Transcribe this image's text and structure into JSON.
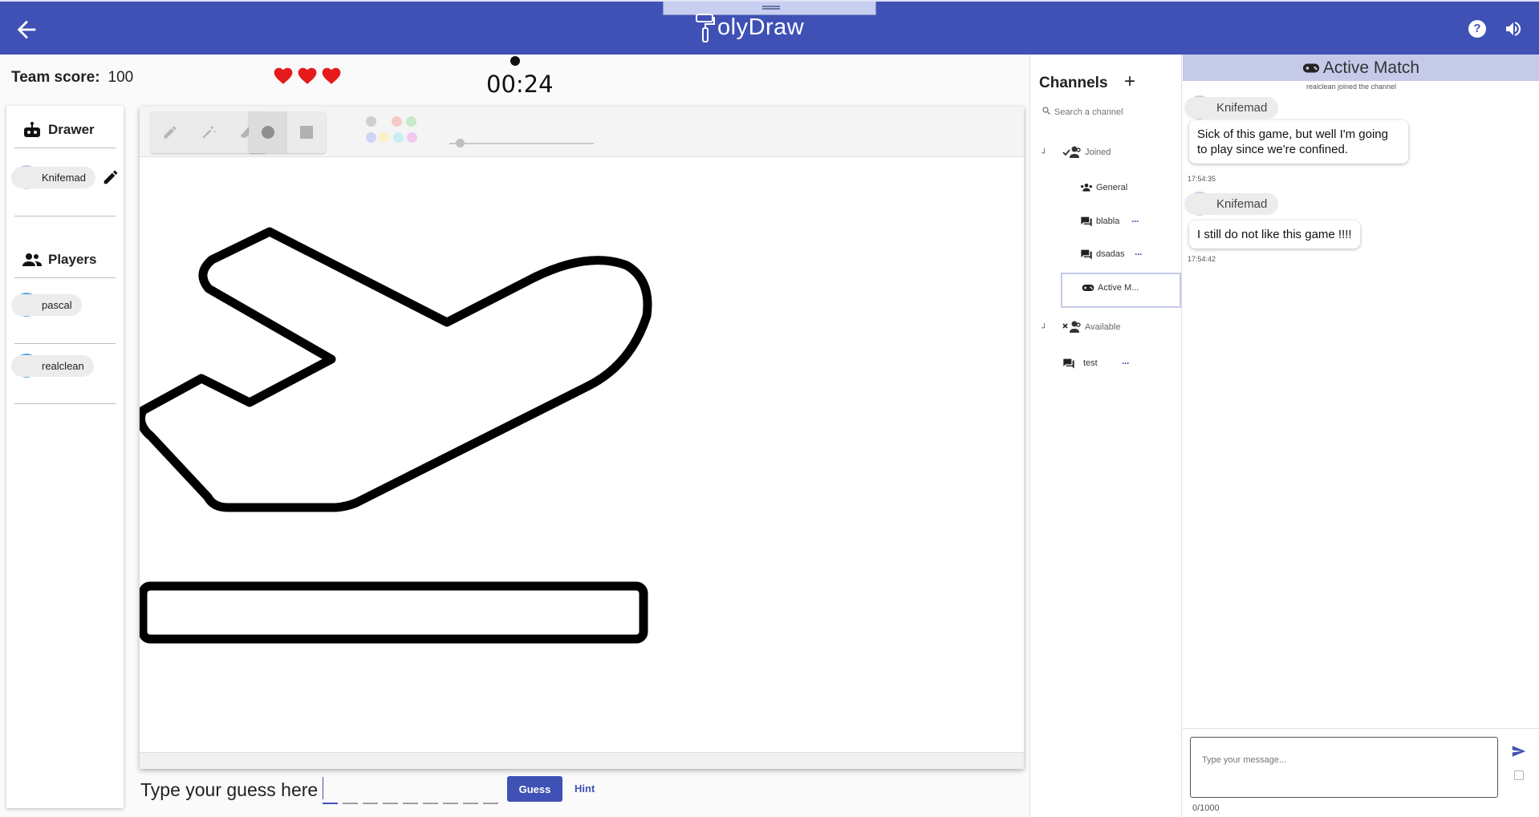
{
  "header": {
    "app_name": "olyDraw",
    "back_icon": "arrow-left-icon",
    "help_icon": "help-circle-icon",
    "sound_icon": "volume-icon"
  },
  "game": {
    "team_score_label": "Team score:",
    "team_score_value": "100",
    "lives": 3,
    "timer": "00:24"
  },
  "left_panel": {
    "drawer_title": "Drawer",
    "drawer": {
      "name": "Knifemad"
    },
    "players_title": "Players",
    "players": [
      {
        "name": "pascal"
      },
      {
        "name": "realclean"
      }
    ]
  },
  "toolbar": {
    "tools": [
      "pencil-icon",
      "magic-pen-icon",
      "eraser-icon"
    ],
    "shapes": [
      "circle-icon",
      "square-icon"
    ],
    "colors": [
      "#cfcfcf",
      "#f6c9c9",
      "#c6e9c6",
      "#cfd3f6",
      "#f9f1c7",
      "#c7eef3",
      "#f3c9f1"
    ],
    "stroke_level": 0.05
  },
  "guess": {
    "prompt": "Type your guess here",
    "letters": 9,
    "guess_label": "Guess",
    "hint_label": "Hint"
  },
  "channels": {
    "title": "Channels",
    "add_label": "+",
    "search_placeholder": "Search a channel",
    "joined_label": "Joined",
    "joined": [
      {
        "name": "General",
        "icon": "group-icon",
        "more": false
      },
      {
        "name": "blabla",
        "icon": "chat-icon",
        "more": true
      },
      {
        "name": "dsadas",
        "icon": "chat-icon",
        "more": true
      },
      {
        "name": "Active M...",
        "icon": "gamepad-icon",
        "more": false
      }
    ],
    "available_label": "Available",
    "available": [
      {
        "name": "test",
        "icon": "chat-icon",
        "more": true
      }
    ],
    "more_label": "···"
  },
  "chat": {
    "title": "Active Match",
    "system_message": "realclean joined the channel",
    "messages": [
      {
        "author": "Knifemad",
        "text": "Sick of this game, but well I'm going to play since we're confined.",
        "time": "17:54:35"
      },
      {
        "author": "Knifemad",
        "text": "I still do not like this game !!!!",
        "time": "17:54:42"
      }
    ],
    "input_placeholder": "Type your message...",
    "char_count": "0/1000"
  },
  "colors": {
    "primary": "#3f51b5",
    "header_light": "#c5cae9",
    "heart": "#e51b1b"
  }
}
